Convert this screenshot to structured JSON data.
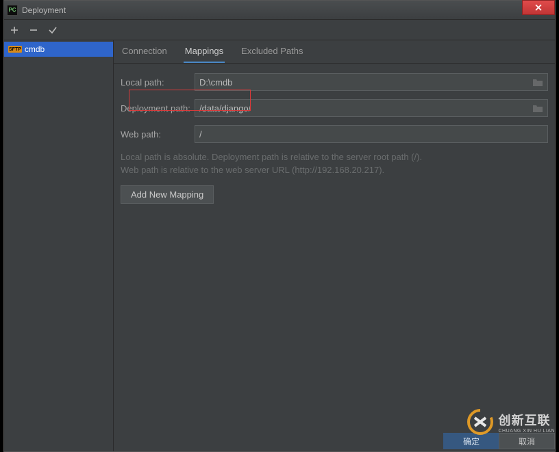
{
  "window": {
    "title": "Deployment"
  },
  "toolbar": {
    "add": "+",
    "remove": "−",
    "check": "✓"
  },
  "sidebar": {
    "server": {
      "protocol": "SFTP",
      "name": "cmdb"
    }
  },
  "tabs": {
    "connection": "Connection",
    "mappings": "Mappings",
    "excluded": "Excluded Paths"
  },
  "form": {
    "local_label": "Local path:",
    "local_value": "D:\\cmdb",
    "deploy_label": "Deployment path:",
    "deploy_value": "/data/django/",
    "web_label": "Web path:",
    "web_value": "/",
    "hint1": "Local path is absolute. Deployment path is relative to the server root path (/).",
    "hint2": "Web path is relative to the web server URL (http://192.168.20.217).",
    "add_mapping": "Add New Mapping"
  },
  "footer": {
    "ok": "确定",
    "cancel": "取消"
  },
  "watermark": {
    "cn": "创新互联",
    "en": "CHUANG XIN HU LIAN"
  }
}
